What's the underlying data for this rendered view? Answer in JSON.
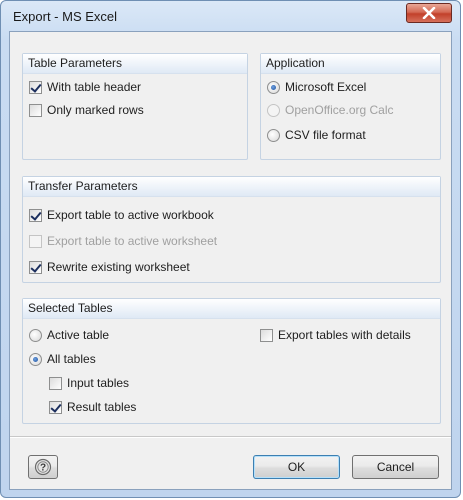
{
  "window": {
    "title": "Export - MS Excel"
  },
  "table_parameters": {
    "header": "Table Parameters",
    "with_table_header": {
      "label": "With table header",
      "checked": true
    },
    "only_marked_rows": {
      "label": "Only marked rows",
      "checked": false
    }
  },
  "application": {
    "header": "Application",
    "options": [
      {
        "label": "Microsoft Excel",
        "selected": true,
        "enabled": true
      },
      {
        "label": "OpenOffice.org Calc",
        "selected": false,
        "enabled": false
      },
      {
        "label": "CSV file format",
        "selected": false,
        "enabled": true
      }
    ]
  },
  "transfer_parameters": {
    "header": "Transfer Parameters",
    "export_to_workbook": {
      "label": "Export table to active workbook",
      "checked": true
    },
    "export_to_worksheet": {
      "label": "Export table to active worksheet",
      "checked": false,
      "enabled": false
    },
    "rewrite_worksheet": {
      "label": "Rewrite existing worksheet",
      "checked": true
    }
  },
  "selected_tables": {
    "header": "Selected Tables",
    "active_table": {
      "label": "Active table",
      "selected": false
    },
    "all_tables": {
      "label": "All tables",
      "selected": true
    },
    "input_tables": {
      "label": "Input tables",
      "checked": false
    },
    "result_tables": {
      "label": "Result tables",
      "checked": true
    },
    "export_with_details": {
      "label": "Export tables with details",
      "checked": false
    }
  },
  "buttons": {
    "ok": "OK",
    "cancel": "Cancel",
    "help_icon": "help-icon"
  }
}
